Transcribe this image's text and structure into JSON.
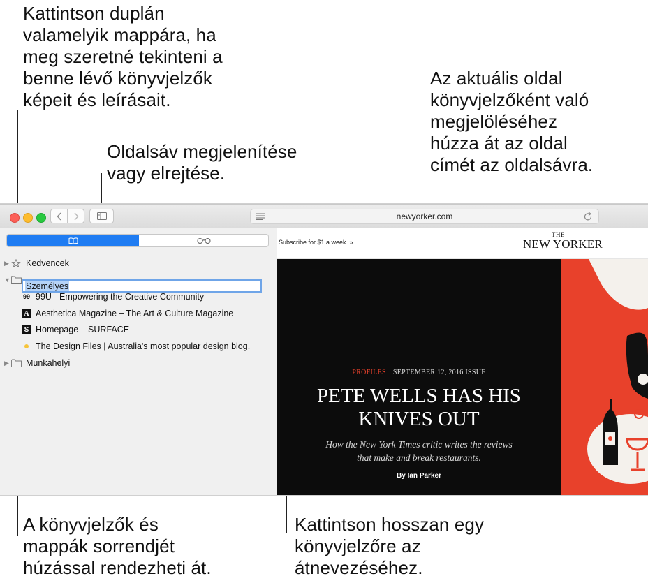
{
  "callouts": {
    "top_left": "Kattintson duplán\nvalamelyik mappára, ha\nmeg szeretné tekinteni a\nbenne lévő könyvjelzők\nképeit és leírásait.",
    "sidebar_toggle": "Oldalsáv megjelenítése\nvagy elrejtése.",
    "top_right": "Az aktuális oldal\nkönyvjelzőként való\nmegjelöléséhez\nhúzza át az oldal\ncímét az oldalsávra.",
    "bottom_left": "A könyvjelzők és\nmappák sorrendjét\nhúzással rendezheti át.",
    "bottom_right": "Kattintson hosszan egy\nkönyvjelzőre az\nátnevezéséhez."
  },
  "toolbar": {
    "url": "newyorker.com"
  },
  "sidebar": {
    "folders": {
      "favorites": "Kedvencek",
      "personal": "Személyes",
      "work": "Munkahelyi"
    },
    "bookmarks": [
      {
        "icon": "99",
        "label": "99U - Empowering the Creative Community"
      },
      {
        "icon": "A",
        "label": "Aesthetica Magazine – The Art & Culture Magazine"
      },
      {
        "icon": "S",
        "label": "Homepage – SURFACE"
      },
      {
        "icon": "dot",
        "label": "The Design Files | Australia's most popular design blog."
      }
    ]
  },
  "page": {
    "subscribe": "Subscribe for $1 a week. »",
    "logo_the": "THE",
    "logo": "NEW YORKER",
    "kicker_tag": "PROFILES",
    "kicker_issue": "SEPTEMBER 12, 2016 ISSUE",
    "headline": "PETE WELLS HAS HIS\nKNIVES OUT",
    "dek": "How the New York Times critic writes the reviews\nthat make and break restaurants.",
    "byline": "By Ian Parker"
  },
  "colors": {
    "accent_blue": "#1f7cf2",
    "close": "#fc5f57",
    "minimize": "#fdbc2e",
    "zoom": "#28c840",
    "illustration_red": "#e8412b"
  }
}
